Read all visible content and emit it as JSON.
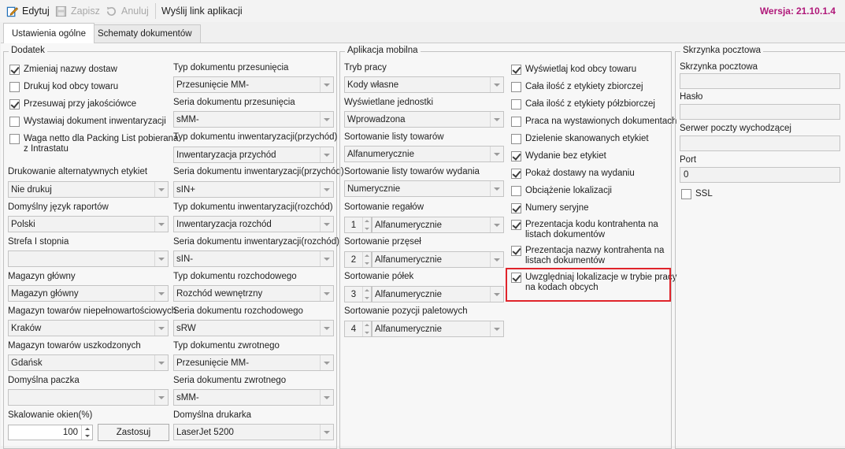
{
  "toolbar": {
    "edit_label": "Edytuj",
    "save_label": "Zapisz",
    "cancel_label": "Anuluj",
    "send_link_label": "Wyślij link aplikacji",
    "version_label": "Wersja:",
    "version_value": "21.10.1.4"
  },
  "tabs": [
    {
      "label": "Ustawienia ogólne"
    },
    {
      "label": "Schematy dokumentów"
    }
  ],
  "colors": {
    "accent": "#b0197a",
    "highlight": "#e0242b"
  },
  "dodatek": {
    "title": "Dodatek",
    "checkboxes": [
      {
        "label": "Zmieniaj nazwy dostaw",
        "checked": true
      },
      {
        "label": "Drukuj kod obcy towaru",
        "checked": false
      },
      {
        "label": "Przesuwaj przy jakościówce",
        "checked": true
      },
      {
        "label": "Wystawiaj dokument inwentaryzacji",
        "checked": false
      },
      {
        "label_line1": "Waga netto dla Packing List pobierana",
        "label_line2": "z Intrastatu",
        "checked": false
      }
    ],
    "left_fields": [
      {
        "label": "Drukowanie alternatywnych etykiet",
        "value": "Nie drukuj"
      },
      {
        "label": "Domyślny język raportów",
        "value": "Polski"
      },
      {
        "label": "Strefa I stopnia",
        "value": ""
      },
      {
        "label": "Magazyn główny",
        "value": "Magazyn główny"
      },
      {
        "label": "Magazyn towarów niepełnowartościowych",
        "value": "Kraków"
      },
      {
        "label": "Magazyn towarów uszkodzonych",
        "value": "Gdańsk"
      },
      {
        "label": "Domyślna paczka",
        "value": ""
      }
    ],
    "scaling": {
      "label": "Skalowanie okien(%)",
      "value": "100",
      "apply_label": "Zastosuj"
    },
    "right_fields": [
      {
        "label": "Typ dokumentu przesunięcia",
        "value": "Przesunięcie MM-"
      },
      {
        "label": "Seria dokumentu przesunięcia",
        "value": "sMM-"
      },
      {
        "label": "Typ dokumentu inwentaryzacji(przychód)",
        "value": "Inwentaryzacja przychód"
      },
      {
        "label": "Seria dokumentu inwentaryzacji(przychód)",
        "value": "sIN+"
      },
      {
        "label": "Typ dokumentu inwentaryzacji(rozchód)",
        "value": "Inwentaryzacja rozchód"
      },
      {
        "label": "Seria dokumentu inwentaryzacji(rozchód)",
        "value": "sIN-"
      },
      {
        "label": "Typ dokumentu rozchodowego",
        "value": "Rozchód wewnętrzny"
      },
      {
        "label": "Seria dokumentu rozchodowego",
        "value": "sRW"
      },
      {
        "label": "Typ dokumentu zwrotnego",
        "value": "Przesunięcie MM-"
      },
      {
        "label": "Seria dokumentu zwrotnego",
        "value": "sMM-"
      },
      {
        "label": "Domyślna drukarka",
        "value": "LaserJet 5200"
      }
    ]
  },
  "mobile": {
    "title": "Aplikacja mobilna",
    "fields": [
      {
        "label": "Tryb pracy",
        "value": "Kody własne"
      },
      {
        "label": "Wyświetlane jednostki",
        "value": "Wprowadzona"
      },
      {
        "label": "Sortowanie listy towarów",
        "value": "Alfanumerycznie"
      },
      {
        "label": "Sortowanie listy towarów wydania",
        "value": "Numerycznie"
      }
    ],
    "spin_fields": [
      {
        "label": "Sortowanie regałów",
        "num": "1",
        "value": "Alfanumerycznie"
      },
      {
        "label": "Sortowanie przęseł",
        "num": "2",
        "value": "Alfanumerycznie"
      },
      {
        "label": "Sortowanie półek",
        "num": "3",
        "value": "Alfanumerycznie"
      },
      {
        "label": "Sortowanie pozycji paletowych",
        "num": "4",
        "value": "Alfanumerycznie"
      }
    ],
    "checkboxes": [
      {
        "label": "Wyświetlaj kod obcy towaru",
        "checked": true
      },
      {
        "label": "Cała ilość z etykiety zbiorczej",
        "checked": false
      },
      {
        "label": "Cała ilość z etykiety półzbiorczej",
        "checked": false
      },
      {
        "label": "Praca na wystawionych dokumentach",
        "checked": false
      },
      {
        "label": "Dzielenie skanowanych etykiet",
        "checked": false
      },
      {
        "label": "Wydanie bez etykiet",
        "checked": true
      },
      {
        "label": "Pokaż dostawy na wydaniu",
        "checked": true
      },
      {
        "label": "Obciążenie lokalizacji",
        "checked": false
      },
      {
        "label": "Numery seryjne",
        "checked": true
      },
      {
        "label_line1": "Prezentacja kodu kontrahenta na",
        "label_line2": "listach dokumentów",
        "checked": true
      },
      {
        "label_line1": "Prezentacja nazwy kontrahenta na",
        "label_line2": "listach dokumentów",
        "checked": true
      },
      {
        "label_line1": "Uwzględniaj lokalizacje w trybie pracy",
        "label_line2": "na kodach obcych",
        "checked": true
      }
    ]
  },
  "mailbox": {
    "title": "Skrzynka pocztowa",
    "fields": [
      {
        "label": "Skrzynka pocztowa",
        "value": ""
      },
      {
        "label": "Hasło",
        "value": ""
      },
      {
        "label": "Serwer poczty wychodzącej",
        "value": ""
      },
      {
        "label": "Port",
        "value": "0"
      }
    ],
    "ssl": {
      "label": "SSL",
      "checked": false
    }
  }
}
